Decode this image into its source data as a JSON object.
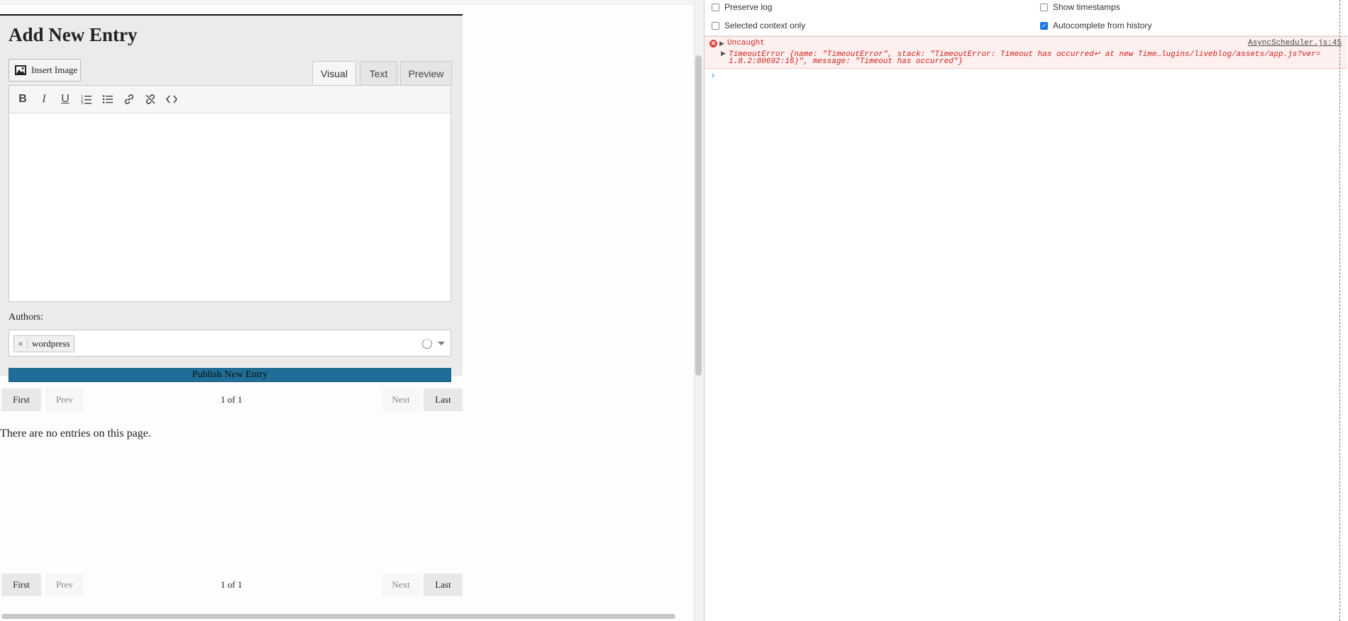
{
  "panel": {
    "title": "Add New Entry",
    "insert_image_label": "Insert Image",
    "tabs": [
      "Visual",
      "Text",
      "Preview"
    ],
    "toolbar_icons": [
      "bold-icon",
      "italic-icon",
      "underline-icon",
      "ordered-list-icon",
      "bullet-list-icon",
      "link-icon",
      "unlink-icon",
      "code-icon"
    ],
    "authors_label": "Authors:",
    "author_tag": "wordpress",
    "author_remove": "×",
    "publish_label": "Publish New Entry"
  },
  "pagination": {
    "first": "First",
    "prev": "Prev",
    "info": "1 of 1",
    "next": "Next",
    "last": "Last"
  },
  "empty_message": "There are no entries on this page.",
  "devtools": {
    "options": {
      "preserve_log": {
        "label": "Preserve log",
        "checked": false
      },
      "selected_context": {
        "label": "Selected context only",
        "checked": false
      },
      "show_timestamps": {
        "label": "Show timestamps",
        "checked": false
      },
      "autocomplete_history": {
        "label": "Autocomplete from history",
        "checked": true
      }
    },
    "error": {
      "title": "Uncaught",
      "source": "AsyncScheduler.js:45",
      "line1": "TimeoutError {name: \"TimeoutError\", stack: \"TimeoutError: Timeout has occurred↵    at new Time…lugins/liveblog/assets/app.js?ver=",
      "line2": "1.8.2:80692:16)\", message: \"Timeout has occurred\"}"
    },
    "prompt": "›"
  },
  "colors": {
    "publish": "#1f6e97",
    "error_text": "#c9221b",
    "error_bg": "#fff0f0",
    "checkbox_checked": "#1a73e8"
  }
}
